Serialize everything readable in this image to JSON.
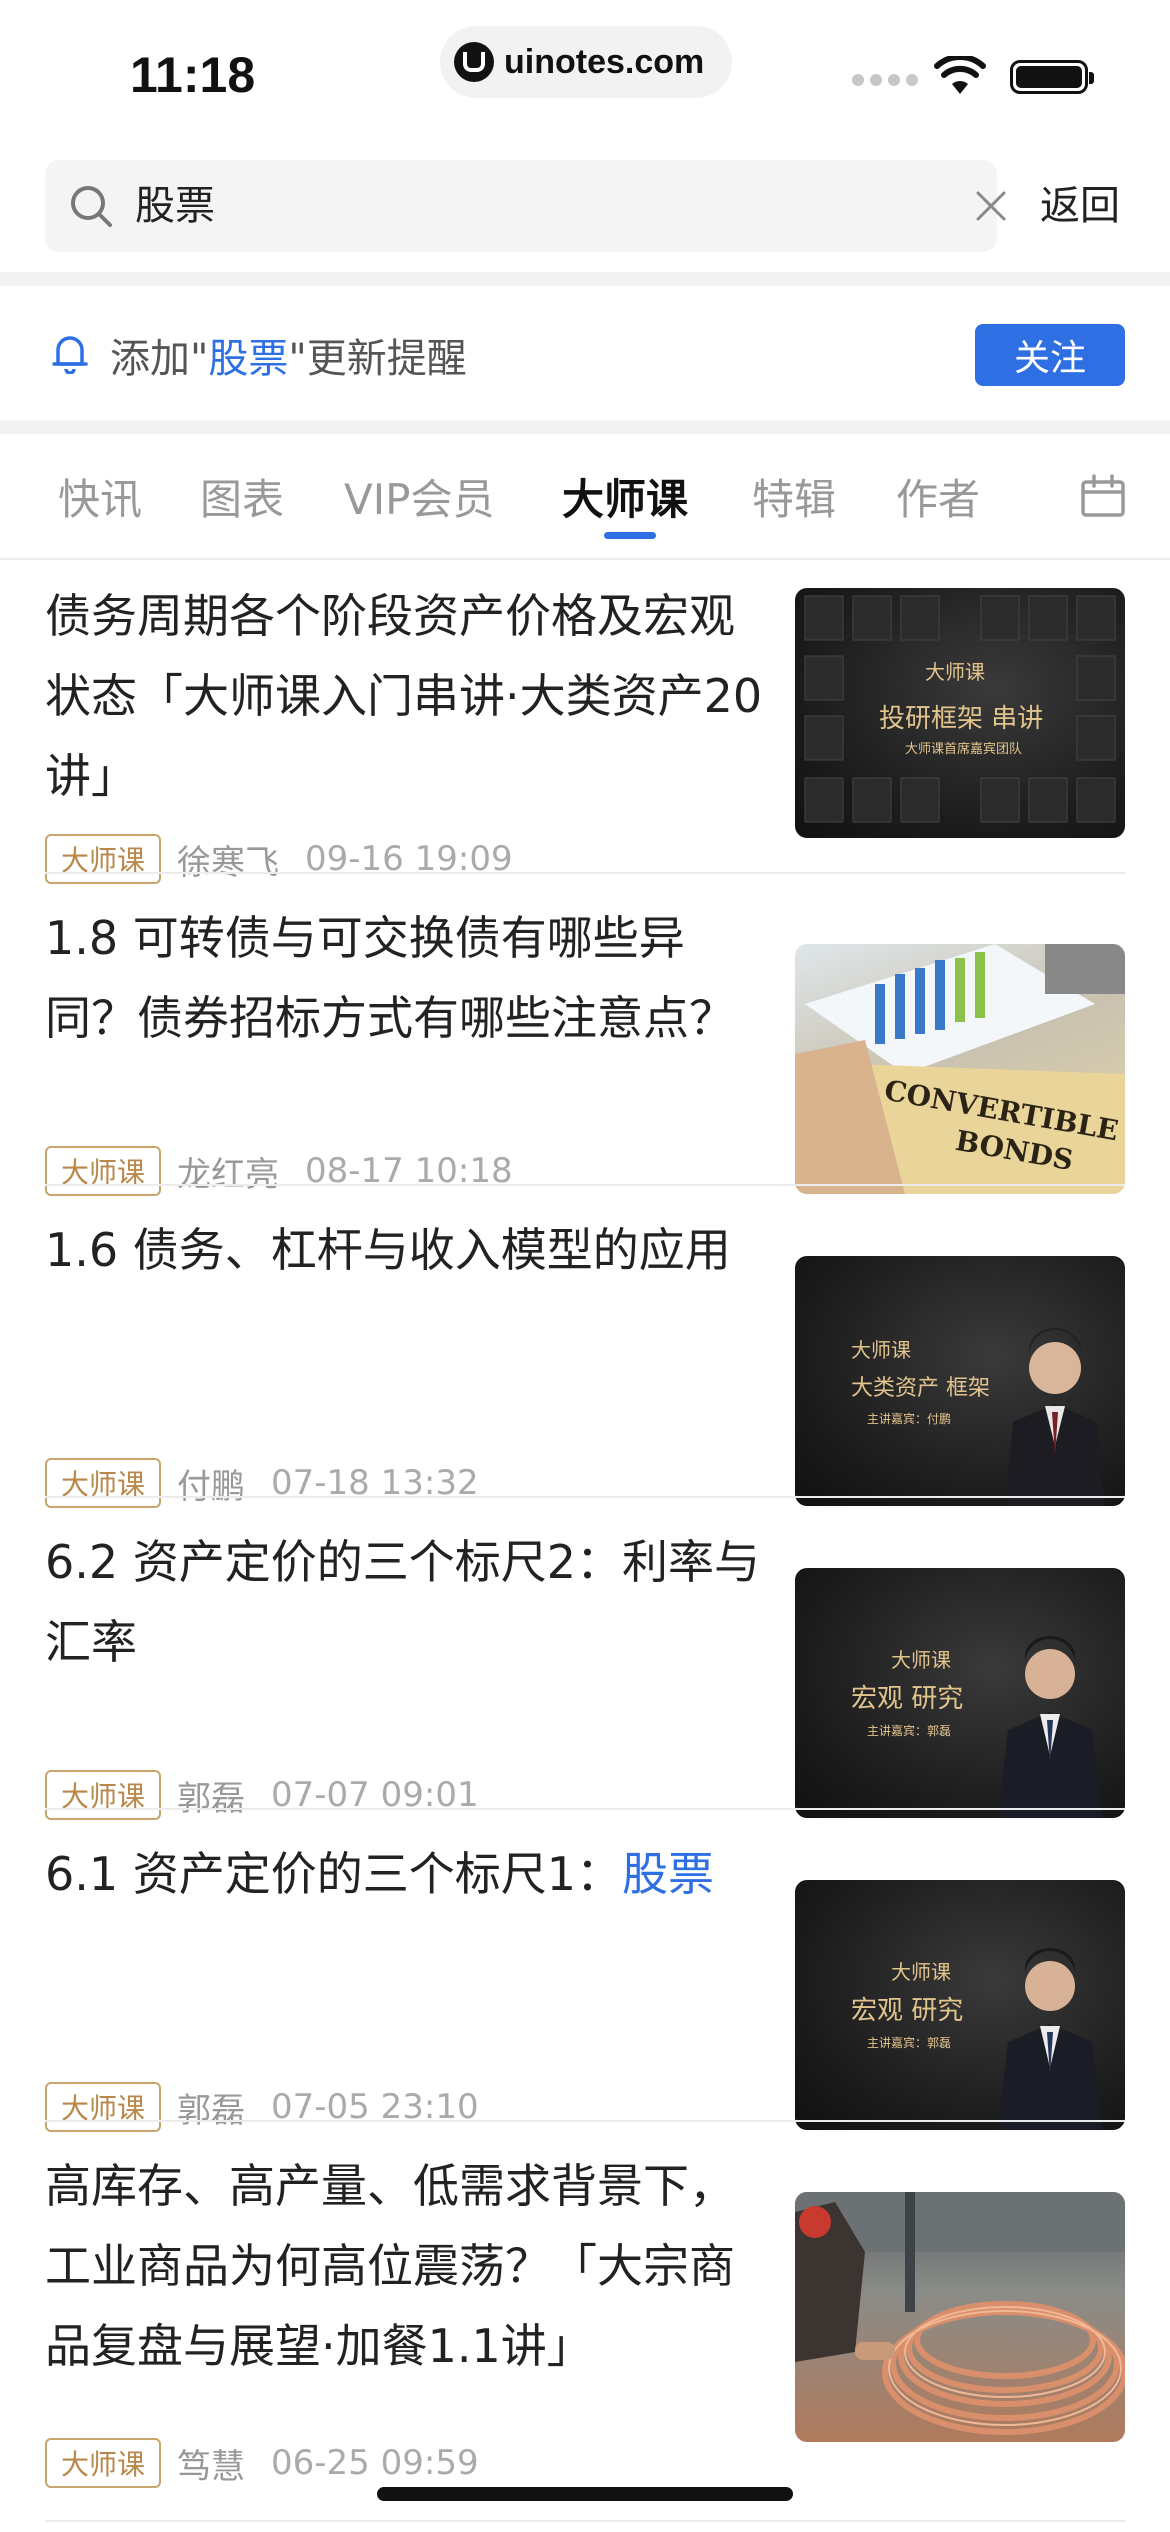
{
  "status": {
    "time": "11:18",
    "url": "uinotes.com"
  },
  "search": {
    "query": "股票",
    "back_label": "返回"
  },
  "alert": {
    "prefix": "添加\"",
    "keyword": "股票",
    "suffix": "\"更新提醒",
    "follow_label": "关注"
  },
  "tabs": [
    {
      "label": "快讯"
    },
    {
      "label": "图表"
    },
    {
      "label": "VIP会员"
    },
    {
      "label": "大师课",
      "active": true
    },
    {
      "label": "特辑"
    },
    {
      "label": "作者"
    }
  ],
  "articles": [
    {
      "title": "债务周期各个阶段资产价格及宏观状态「大师课入门串讲·大类资产20讲」",
      "badge": "大师课",
      "author": "徐寒飞",
      "time": "09-16 19:09",
      "thumb": {
        "logo": "大师课",
        "main": "投研框架 串讲",
        "sub": "大师课首席嘉宾团队"
      }
    },
    {
      "title": "1.8 可转债与可交换债有哪些异同？债券招标方式有哪些注意点？",
      "badge": "大师课",
      "author": "龙红亮",
      "time": "08-17 10:18",
      "thumb": {
        "line1": "CONVERTIBLE",
        "line2": "BONDS"
      }
    },
    {
      "title": "1.6 债务、杠杆与收入模型的应用",
      "badge": "大师课",
      "author": "付鹏",
      "time": "07-18 13:32",
      "thumb": {
        "logo": "大师课",
        "main": "大类资产 框架",
        "sub": "主讲嘉宾：付鹏"
      }
    },
    {
      "title": "6.2  资产定价的三个标尺2：利率与汇率",
      "badge": "大师课",
      "author": "郭磊",
      "time": "07-07 09:01",
      "thumb": {
        "logo": "大师课",
        "main": "宏观 研究",
        "sub": "主讲嘉宾：郭磊"
      }
    },
    {
      "title_prefix": "6.1 资产定价的三个标尺1：",
      "title_highlight": "股票",
      "badge": "大师课",
      "author": "郭磊",
      "time": "07-05 23:10",
      "thumb": {
        "logo": "大师课",
        "main": "宏观 研究",
        "sub": "主讲嘉宾：郭磊"
      }
    },
    {
      "title": "高库存、高产量、低需求背景下，工业商品为何高位震荡？「大宗商品复盘与展望·加餐1.1讲」",
      "badge": "大师课",
      "author": "笃慧",
      "time": "06-25 09:59"
    }
  ],
  "colors": {
    "accent": "#2f6fe4",
    "badge": "#c9a46c",
    "thumb_gold": "#e2c48d"
  }
}
